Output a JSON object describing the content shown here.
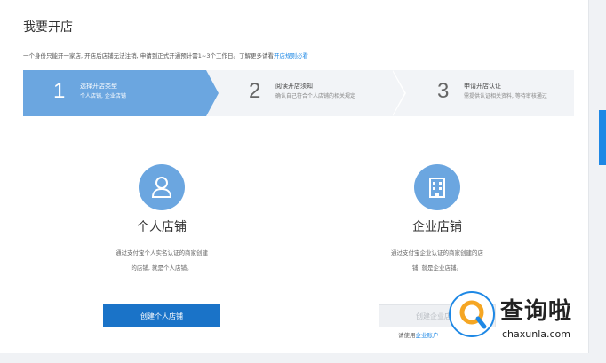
{
  "page": {
    "title": "我要开店",
    "notice_text": "一个身份只能开一家店, 开店后店铺无法注销, 申请到正式开通预计需1~3个工作日。了解更多请看",
    "notice_link": "开店规则必看"
  },
  "steps": [
    {
      "number": "1",
      "title": "选择开店类型",
      "desc": "个人店铺, 企业店铺",
      "state": "active"
    },
    {
      "number": "2",
      "title": "阅读开店须知",
      "desc": "确认自己符合个人店铺的相关规定",
      "state": "pending"
    },
    {
      "number": "3",
      "title": "申请开店认证",
      "desc": "需提供认证相关资料, 等待审核通过",
      "state": "pending"
    }
  ],
  "cards": {
    "personal": {
      "icon": "person-icon",
      "title": "个人店铺",
      "desc_line1": "通过支付宝个人实名认证的商家创建",
      "desc_line2": "的店铺, 就是个人店铺。",
      "button": "创建个人店铺",
      "button_enabled": true
    },
    "enterprise": {
      "icon": "building-icon",
      "title": "企业店铺",
      "desc_line1": "通过支付宝企业认证的商家创建的店",
      "desc_line2": "铺, 就是企业店铺。",
      "button": "创建企业店铺",
      "button_enabled": false,
      "hint_text": "请使用",
      "hint_link": "企业账户"
    }
  },
  "watermark": {
    "text": "查询啦",
    "sub": "chaxunla.com"
  },
  "colors": {
    "accent": "#1a73c8",
    "active_step": "#6ba6e0",
    "inactive_step": "#f2f4f7",
    "link": "#1e88e5"
  }
}
